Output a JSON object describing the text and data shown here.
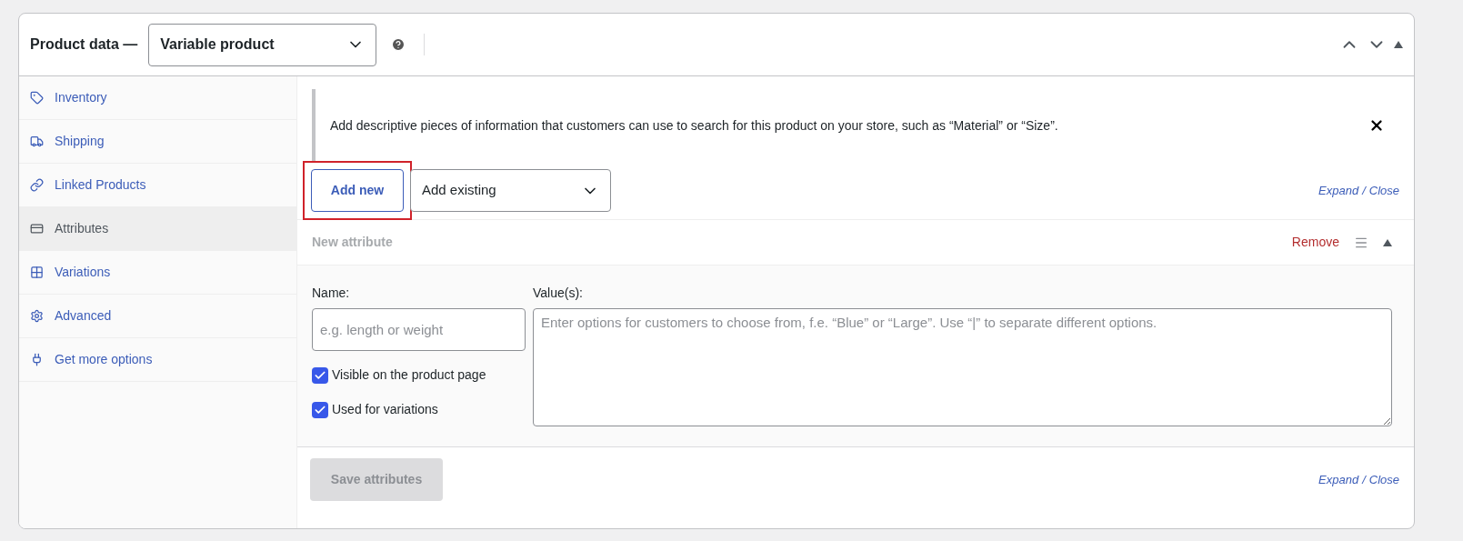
{
  "header": {
    "title": "Product data —",
    "product_type": "Variable product"
  },
  "sidebar": {
    "items": [
      {
        "label": "Inventory",
        "selected": false
      },
      {
        "label": "Shipping",
        "selected": false
      },
      {
        "label": "Linked Products",
        "selected": false
      },
      {
        "label": "Attributes",
        "selected": true
      },
      {
        "label": "Variations",
        "selected": false
      },
      {
        "label": "Advanced",
        "selected": false
      },
      {
        "label": "Get more options",
        "selected": false
      }
    ]
  },
  "notice": {
    "text": "Add descriptive pieces of information that customers can use to search for this product on your store, such as “Material” or “Size”."
  },
  "toolbar": {
    "add_new": {
      "label": "Add new",
      "highlighted": true
    },
    "add_existing": "Add existing",
    "expand": "Expand",
    "separator": "/",
    "close": "Close"
  },
  "attribute": {
    "title": "New attribute",
    "remove": "Remove",
    "name_label": "Name:",
    "name_placeholder": "e.g. length or weight",
    "values_label": "Value(s):",
    "values_placeholder": "Enter options for customers to choose from, f.e. “Blue” or “Large”. Use “|” to separate different options.",
    "options": [
      {
        "label": "Visible on the product page",
        "checked": true
      },
      {
        "label": "Used for variations",
        "checked": true
      }
    ]
  },
  "footer": {
    "save": "Save attributes",
    "save_disabled": true,
    "expand": "Expand",
    "separator": "/",
    "close": "Close"
  }
}
